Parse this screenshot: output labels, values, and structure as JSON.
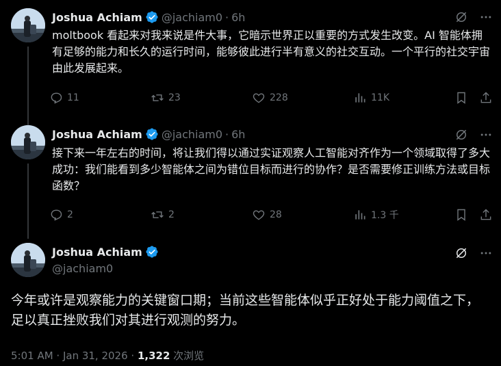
{
  "tweets": [
    {
      "name": "Joshua Achiam",
      "handle": "@jachiam0",
      "sep": "·",
      "time": "6h",
      "text": "moltbook 看起来对我来说是件大事，它暗示世界正以重要的方式发生改变。AI 智能体拥有足够的能力和长久的运行时间，能够彼此进行半有意义的社交互动。一个平行的社交宇宙由此发展起来。",
      "replies": "11",
      "reposts": "23",
      "likes": "228",
      "views": "11K"
    },
    {
      "name": "Joshua Achiam",
      "handle": "@jachiam0",
      "sep": "·",
      "time": "6h",
      "text": "接下来一年左右的时间，将让我们得以通过实证观察人工智能对齐作为一个领域取得了多大成功：我们能看到多少智能体之间为错位目标而进行的协作？是否需要修正训练方法或目标函数？",
      "replies": "2",
      "reposts": "2",
      "likes": "28",
      "views": "1.3 千"
    }
  ],
  "main": {
    "name": "Joshua Achiam",
    "handle": "@jachiam0",
    "text": "今年或许是观察能力的关键窗口期；当前这些智能体似乎正好处于能力阈值之下，足以真正挫败我们对其进行观测的努力。",
    "timestamp": "5:01 AM · Jan 31, 2026 · ",
    "views_count": "1,322",
    "views_label": " 次浏览"
  },
  "icons": {
    "verified": "verified-badge-icon",
    "grok": "grok-icon",
    "more": "more-icon",
    "reply": "reply-icon",
    "repost": "repost-icon",
    "like": "like-icon",
    "views": "views-icon",
    "bookmark": "bookmark-icon",
    "share": "share-icon"
  },
  "colors": {
    "background": "#000000",
    "text": "#e7e9ea",
    "secondary": "#71767b",
    "verified": "#1d9bf0",
    "thread_line": "#333639"
  }
}
